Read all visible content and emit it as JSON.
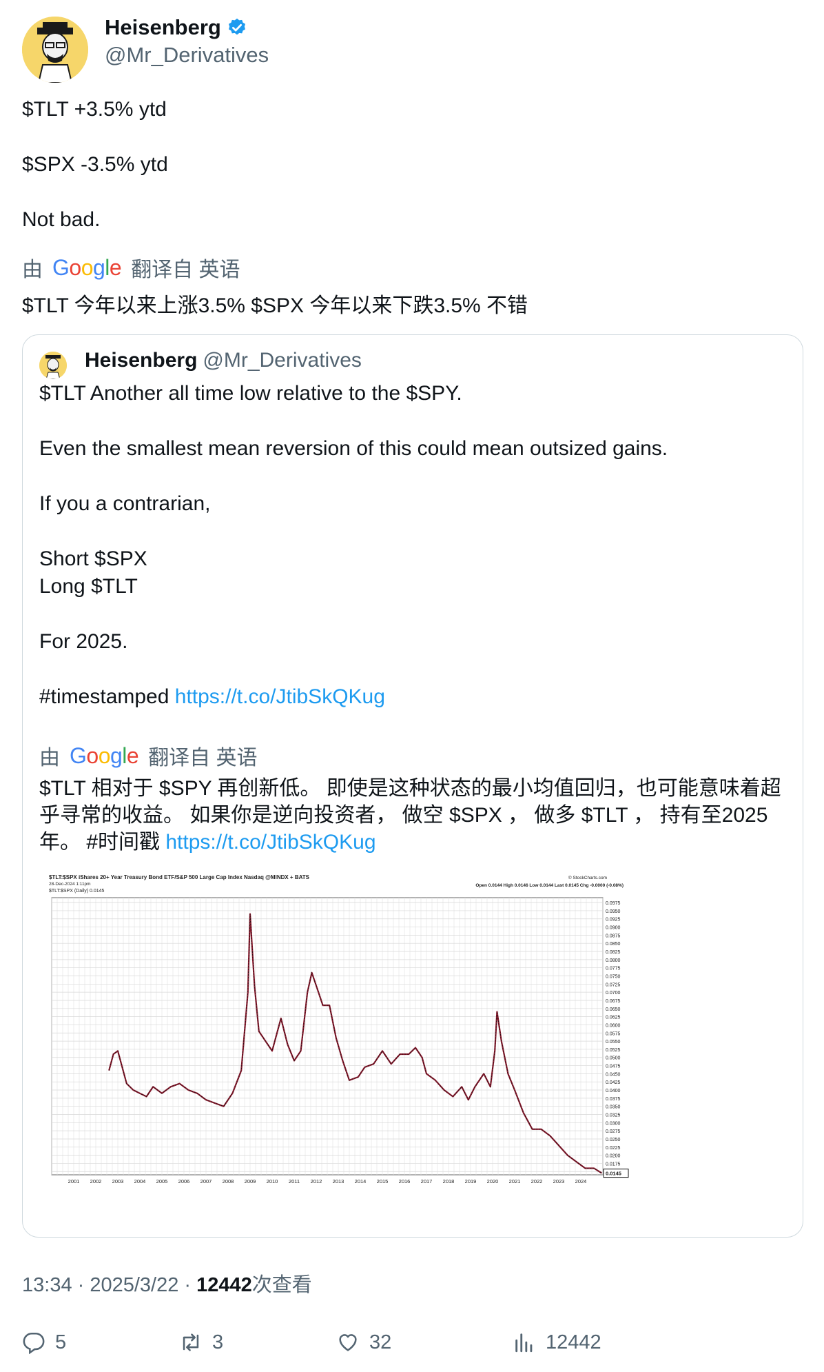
{
  "author": {
    "display_name": "Heisenberg",
    "handle": "@Mr_Derivatives",
    "verified": true
  },
  "tweet": {
    "lines": [
      "$TLT +3.5% ytd",
      "$SPX -3.5% ytd",
      "Not bad."
    ],
    "translation_label_prefix": "由",
    "translation_label_suffix": "翻译自 英语",
    "translation": "$TLT 今年以来上涨3.5% $SPX 今年以来下跌3.5% 不错"
  },
  "quote": {
    "display_name": "Heisenberg",
    "handle": "@Mr_Derivatives",
    "lines": [
      "$TLT Another all time low relative to the $SPY.",
      "Even the smallest mean reversion of this could mean outsized gains.",
      "If you a contrarian,",
      "Short $SPX",
      "Long $TLT",
      "For 2025.",
      "#timestamped "
    ],
    "link": "https://t.co/JtibSkQKug",
    "translation_label_prefix": "由",
    "translation_label_suffix": "翻译自 英语",
    "translation": "$TLT 相对于 $SPY 再创新低。 即使是这种状态的最小均值回归，也可能意味着超乎寻常的收益。 如果你是逆向投资者， 做空 $SPX ， 做多 $TLT ， 持有至2025年。 #时间戳 ",
    "translation_link": "https://t.co/JtibSkQKug"
  },
  "chart_data": {
    "type": "line",
    "title": "$TLT:$SPX iShares 20+ Year Treasury Bond ETF/S&P 500 Large Cap Index Nasdaq @MINDX + BATS",
    "date_label": "28-Dec-2024 1:11pm",
    "legend": "$TLT:$SPX (Daily) 0.0145",
    "source": "© StockCharts.com",
    "ohlc_text": "Open 0.0144  High 0.0146  Low 0.0144  Last 0.0145  Chg -0.0000 (-0.08%)",
    "x_ticks": [
      "2001",
      "2002",
      "2003",
      "2004",
      "2005",
      "2006",
      "2007",
      "2008",
      "2009",
      "2010",
      "2011",
      "2012",
      "2013",
      "2014",
      "2015",
      "2016",
      "2017",
      "2018",
      "2019",
      "2020",
      "2021",
      "2022",
      "2023",
      "2024"
    ],
    "y_ticks": [
      "0.0975",
      "0.0950",
      "0.0925",
      "0.0900",
      "0.0875",
      "0.0850",
      "0.0825",
      "0.0800",
      "0.0775",
      "0.0750",
      "0.0725",
      "0.0700",
      "0.0675",
      "0.0650",
      "0.0625",
      "0.0600",
      "0.0575",
      "0.0550",
      "0.0525",
      "0.0500",
      "0.0475",
      "0.0450",
      "0.0425",
      "0.0400",
      "0.0375",
      "0.0350",
      "0.0325",
      "0.0300",
      "0.0275",
      "0.0250",
      "0.0225",
      "0.0200",
      "0.0175",
      "0.0150"
    ],
    "ylim": [
      0.014,
      0.099
    ],
    "xlim": [
      2000.0,
      2025.0
    ],
    "last_value_label": "0.0145",
    "series": [
      {
        "x": [
          2002.6,
          2002.8,
          2003.0,
          2003.2,
          2003.4,
          2003.7,
          2004.0,
          2004.3,
          2004.6,
          2005.0,
          2005.4,
          2005.8,
          2006.2,
          2006.6,
          2007.0,
          2007.4,
          2007.8,
          2008.2,
          2008.6,
          2008.9,
          2009.0,
          2009.2,
          2009.4,
          2009.7,
          2010.0,
          2010.4,
          2010.7,
          2011.0,
          2011.3,
          2011.6,
          2011.8,
          2012.0,
          2012.3,
          2012.6,
          2012.9,
          2013.2,
          2013.5,
          2013.9,
          2014.2,
          2014.6,
          2015.0,
          2015.4,
          2015.8,
          2016.2,
          2016.5,
          2016.8,
          2017.0,
          2017.4,
          2017.8,
          2018.2,
          2018.6,
          2018.9,
          2019.2,
          2019.6,
          2019.9,
          2020.1,
          2020.2,
          2020.4,
          2020.7,
          2021.0,
          2021.4,
          2021.8,
          2022.2,
          2022.6,
          2023.0,
          2023.4,
          2023.8,
          2024.2,
          2024.6,
          2024.95
        ],
        "y": [
          0.046,
          0.051,
          0.052,
          0.047,
          0.042,
          0.04,
          0.039,
          0.038,
          0.041,
          0.039,
          0.041,
          0.042,
          0.04,
          0.039,
          0.037,
          0.036,
          0.035,
          0.039,
          0.046,
          0.07,
          0.094,
          0.072,
          0.058,
          0.055,
          0.052,
          0.062,
          0.054,
          0.049,
          0.052,
          0.07,
          0.076,
          0.072,
          0.066,
          0.066,
          0.056,
          0.049,
          0.043,
          0.044,
          0.047,
          0.048,
          0.052,
          0.048,
          0.051,
          0.051,
          0.053,
          0.05,
          0.045,
          0.043,
          0.04,
          0.038,
          0.041,
          0.037,
          0.041,
          0.045,
          0.041,
          0.052,
          0.064,
          0.055,
          0.045,
          0.04,
          0.033,
          0.028,
          0.028,
          0.026,
          0.023,
          0.02,
          0.018,
          0.016,
          0.016,
          0.0145
        ]
      }
    ]
  },
  "meta": {
    "time": "13:34 · 2025/3/22 · ",
    "views_count": "12442",
    "views_label": "次查看"
  },
  "actions": {
    "replies": "5",
    "retweets": "3",
    "likes": "32",
    "views": "12442"
  },
  "colors": {
    "link": "#1d9bf0",
    "secondary": "#536471",
    "verified": "#1d9bf0",
    "series": "#8b1a2e"
  }
}
